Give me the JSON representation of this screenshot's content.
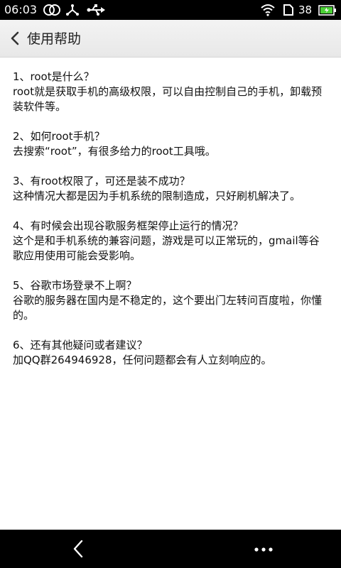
{
  "status_bar": {
    "time": "06:03",
    "battery_level": "38",
    "icons": [
      "circles-icon",
      "usb-network-icon",
      "usb-icon",
      "wifi-icon",
      "sim-icon",
      "battery-icon"
    ]
  },
  "header": {
    "title": "使用帮助",
    "back_icon": "chevron-left-icon"
  },
  "faq": [
    {
      "question": "1、root是什么？",
      "answer": "root就是获取手机的高级权限，可以自由控制自己的手机，卸载预装软件等。"
    },
    {
      "question": "2、如何root手机？",
      "answer": "去搜索“root”，有很多给力的root工具哦。"
    },
    {
      "question": "3、有root权限了，可还是装不成功？",
      "answer": "这种情况大都是因为手机系统的限制造成，只好刷机解决了。"
    },
    {
      "question": "4、有时候会出现谷歌服务框架停止运行的情况？",
      "answer": "这个是和手机系统的兼容问题，游戏是可以正常玩的，gmail等谷歌应用使用可能会受影响。"
    },
    {
      "question": "5、谷歌市场登录不上啊？",
      "answer": "谷歌的服务器在国内是不稳定的，这个要出门左转问百度啦，你懂的。"
    },
    {
      "question": "6、还有其他疑问或者建议？",
      "answer": "加QQ群264946928，任何问题都会有人立刻响应的。"
    }
  ],
  "nav_bar": {
    "back_icon": "back-arrow-icon",
    "more_icon": "more-dots-icon"
  },
  "colors": {
    "status_bar_bg": "#000000",
    "title_bar_bg": "#eeeeee",
    "text": "#111111",
    "battery_fill": "#4cd137"
  }
}
